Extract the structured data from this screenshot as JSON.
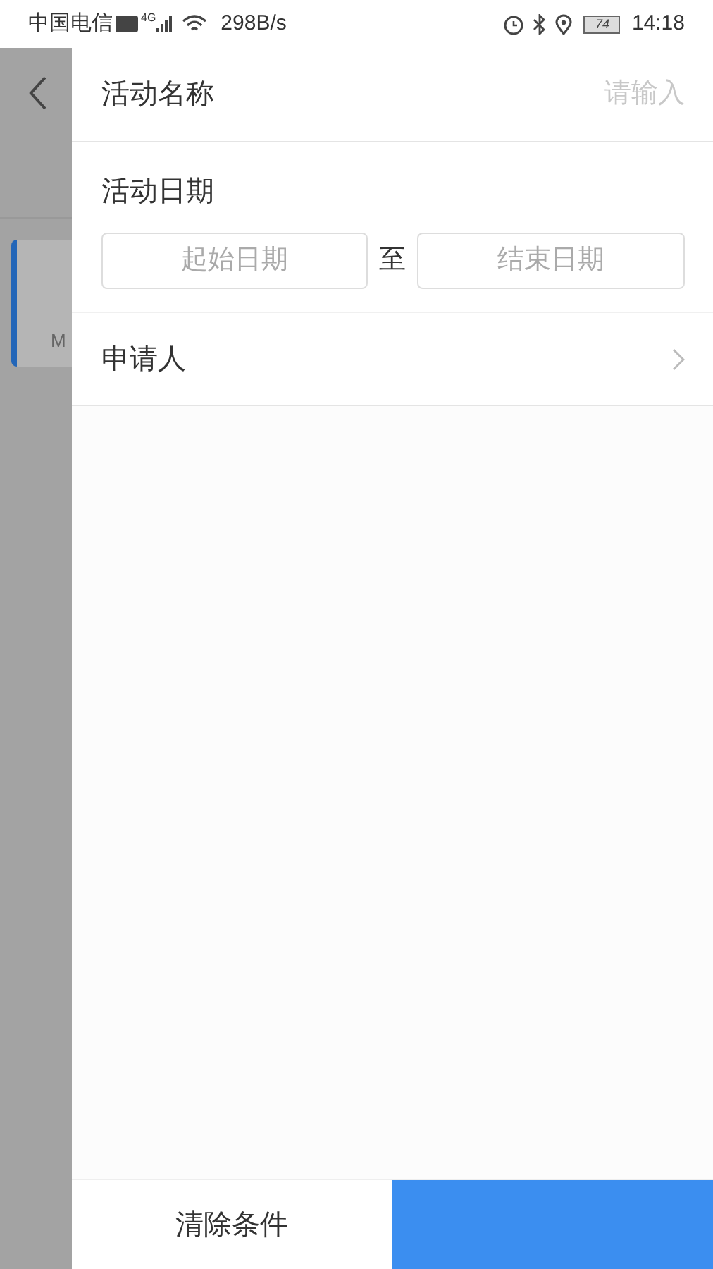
{
  "status_bar": {
    "carrier": "中国电信",
    "network": "4G",
    "speed": "298B/s",
    "battery": "74",
    "time": "14:18"
  },
  "background": {
    "card_text": "M"
  },
  "filter_panel": {
    "name_field": {
      "label": "活动名称",
      "placeholder": "请输入"
    },
    "date_range": {
      "label": "活动日期",
      "start_placeholder": "起始日期",
      "separator": "至",
      "end_placeholder": "结束日期"
    },
    "applicant": {
      "label": "申请人"
    }
  },
  "footer": {
    "clear_button": "清除条件"
  }
}
